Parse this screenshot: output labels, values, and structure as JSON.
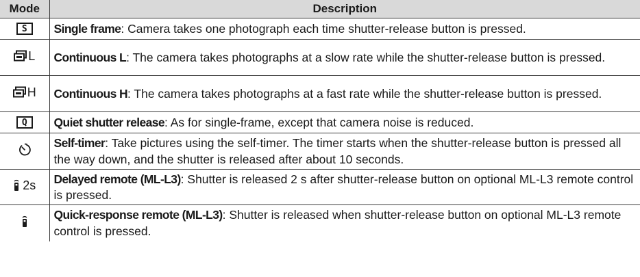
{
  "table": {
    "headers": {
      "mode": "Mode",
      "description": "Description"
    },
    "rows": [
      {
        "mode_icon": "single-frame-icon",
        "mode_text": "S",
        "name": "Single frame",
        "text": ": Camera takes one photograph each time shutter-release button is pressed."
      },
      {
        "mode_icon": "continuous-l-icon",
        "mode_text": "L",
        "name": "Continuous L",
        "text": ": The camera takes photographs at a slow rate while the shutter-release button is pressed."
      },
      {
        "mode_icon": "continuous-h-icon",
        "mode_text": "H",
        "name": "Continuous H",
        "text": ": The camera takes photographs at a fast rate while the shutter-release button is pressed."
      },
      {
        "mode_icon": "quiet-shutter-icon",
        "mode_text": "Q",
        "name": "Quiet shutter release",
        "text": ": As for single-frame, except that camera noise is reduced."
      },
      {
        "mode_icon": "self-timer-icon",
        "mode_text": "",
        "name": "Self-timer",
        "text": ": Take pictures using the self-timer.  The timer starts when the shutter-release button is pressed all the way down, and the shutter is released after about 10 seconds."
      },
      {
        "mode_icon": "delayed-remote-icon",
        "mode_text": "2s",
        "name": "Delayed remote (ML-L3)",
        "text": ": Shutter is released 2 s after shutter-release button on optional ML-L3 remote control is pressed."
      },
      {
        "mode_icon": "quick-response-remote-icon",
        "mode_text": "",
        "name": "Quick-response remote (ML-L3)",
        "text": ": Shutter is released when shutter-release button on optional ML-L3 remote control is pressed."
      }
    ]
  }
}
